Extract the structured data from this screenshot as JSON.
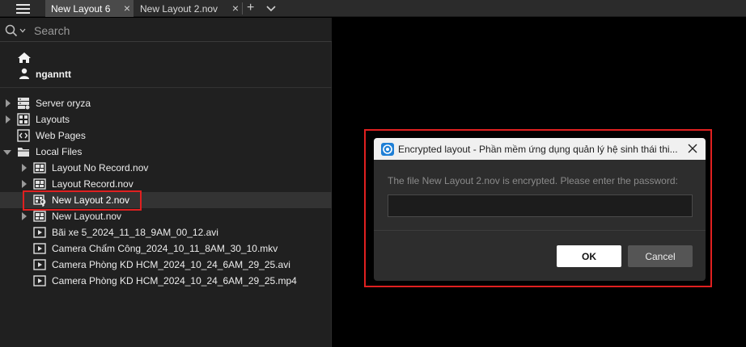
{
  "tabs": [
    {
      "label": "New Layout 6",
      "active": true
    },
    {
      "label": "New Layout 2.nov",
      "active": false
    }
  ],
  "search": {
    "placeholder": "Search"
  },
  "user": {
    "name": "nganntt"
  },
  "tree": [
    {
      "label": "Server oryza",
      "icon": "server-icon",
      "expandable": true,
      "expanded": false
    },
    {
      "label": "Layouts",
      "icon": "layouts-icon",
      "expandable": true,
      "expanded": false
    },
    {
      "label": "Web Pages",
      "icon": "web-pages-icon",
      "expandable": false
    },
    {
      "label": "Local Files",
      "icon": "folder-icon",
      "expandable": true,
      "expanded": true
    },
    {
      "label": "Layout No Record.nov",
      "icon": "layout-file-icon",
      "expandable": true
    },
    {
      "label": "Layout Record.nov",
      "icon": "layout-file-icon",
      "expandable": true
    },
    {
      "label": "New Layout 2.nov",
      "icon": "locked-layout-file-icon",
      "expandable": false,
      "selected": true
    },
    {
      "label": "New Layout.nov",
      "icon": "layout-file-icon",
      "expandable": true
    },
    {
      "label": "Bãi xe 5_2024_11_18_9AM_00_12.avi",
      "icon": "video-file-icon"
    },
    {
      "label": "Camera Chấm Công_2024_10_11_8AM_30_10.mkv",
      "icon": "video-file-icon"
    },
    {
      "label": "Camera Phòng KD HCM_2024_10_24_6AM_29_25.avi",
      "icon": "video-file-icon"
    },
    {
      "label": "Camera Phòng KD HCM_2024_10_24_6AM_29_25.mp4",
      "icon": "video-file-icon"
    }
  ],
  "dialog": {
    "title": "Encrypted layout - Phần mềm ứng dụng quản lý hệ sinh thái thi...",
    "message": "The file New Layout 2.nov is encrypted. Please enter the password:",
    "password_value": "",
    "ok_label": "OK",
    "cancel_label": "Cancel"
  },
  "colors": {
    "highlight": "#e02020",
    "panel": "#202020",
    "selected_row": "#333333"
  }
}
